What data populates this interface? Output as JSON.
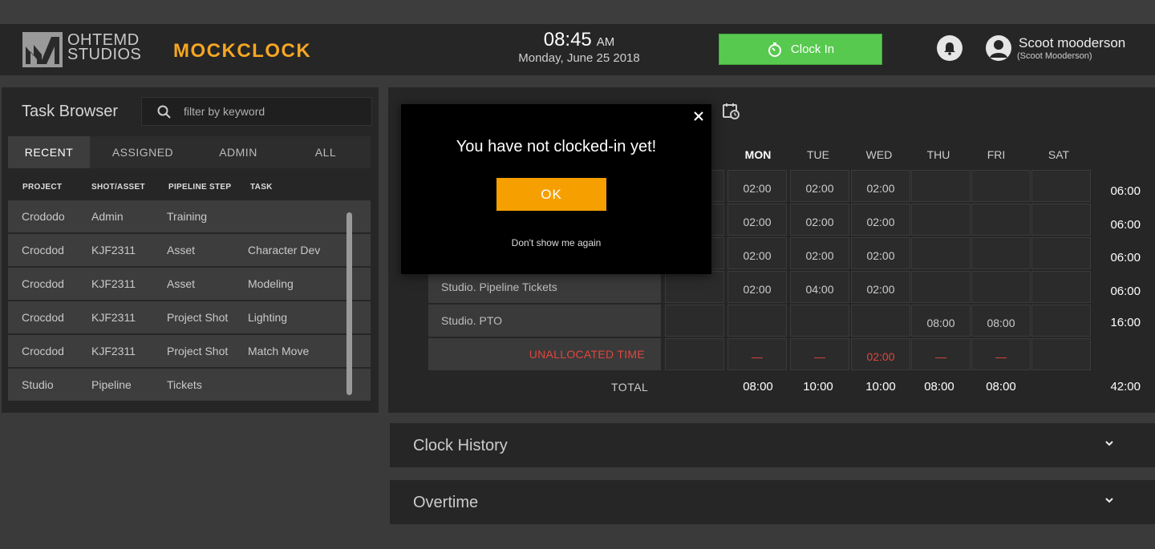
{
  "header": {
    "logo_line1": "OHTEMD",
    "logo_line2": "STUDIOS",
    "brand": "MOCKCLOCK",
    "time": "08:45",
    "ampm": "AM",
    "date": "Monday, June 25 2018",
    "clock_in_label": "Clock In",
    "user_name": "Scoot mooderson",
    "user_sub": "(Scoot Mooderson)"
  },
  "task_browser": {
    "title": "Task Browser",
    "search_placeholder": "filter by keyword",
    "tabs": [
      "RECENT",
      "ASSIGNED",
      "ADMIN",
      "ALL"
    ],
    "active_tab": "RECENT",
    "columns": [
      "PROJECT",
      "SHOT/ASSET",
      "PIPELINE STEP",
      "TASK"
    ],
    "rows": [
      {
        "project": "Crododo",
        "shot": "Admin",
        "step": "Training",
        "task": ""
      },
      {
        "project": "Crocdod",
        "shot": "KJF2311",
        "step": "Asset",
        "task": "Character Dev"
      },
      {
        "project": "Crocdod",
        "shot": "KJF2311",
        "step": "Asset",
        "task": "Modeling"
      },
      {
        "project": "Crocdod",
        "shot": "KJF2311",
        "step": "Project Shot",
        "task": "Lighting"
      },
      {
        "project": "Crocdod",
        "shot": "KJF2311",
        "step": "Project Shot",
        "task": "Match Move"
      },
      {
        "project": "Studio",
        "shot": "Pipeline",
        "step": "Tickets",
        "task": ""
      }
    ]
  },
  "timesheet": {
    "days": [
      "MON",
      "TUE",
      "WED",
      "THU",
      "FRI",
      "SAT"
    ],
    "rows": [
      {
        "label": "",
        "cells": [
          "02:00",
          "02:00",
          "02:00",
          "",
          "",
          ""
        ],
        "total": "06:00"
      },
      {
        "label": "",
        "cells": [
          "02:00",
          "02:00",
          "02:00",
          "",
          "",
          ""
        ],
        "total": "06:00"
      },
      {
        "label": "",
        "cells": [
          "02:00",
          "02:00",
          "02:00",
          "",
          "",
          ""
        ],
        "total": "06:00"
      },
      {
        "label": "Studio. Pipeline Tickets",
        "cells": [
          "02:00",
          "04:00",
          "02:00",
          "",
          "",
          ""
        ],
        "total": "06:00"
      },
      {
        "label": "Studio. PTO",
        "cells": [
          "",
          "",
          "",
          "08:00",
          "08:00",
          ""
        ],
        "total": "16:00"
      }
    ],
    "unallocated": {
      "label": "UNALLOCATED TIME",
      "cells": [
        "—",
        "—",
        "02:00",
        "—",
        "—",
        ""
      ]
    },
    "total_label": "TOTAL",
    "totals": [
      "08:00",
      "10:00",
      "10:00",
      "08:00",
      "08:00"
    ],
    "grand_total": "42:00",
    "accent_red": "#e0463f"
  },
  "panels": {
    "clock_history": "Clock History",
    "overtime": "Overtime"
  },
  "modal": {
    "message": "You have not clocked-in yet!",
    "ok_label": "OK",
    "dont_show": "Don't show me again"
  },
  "colors": {
    "brand_orange": "#f5a623",
    "clock_in_green": "#57c94f",
    "ok_orange": "#f5a000"
  }
}
